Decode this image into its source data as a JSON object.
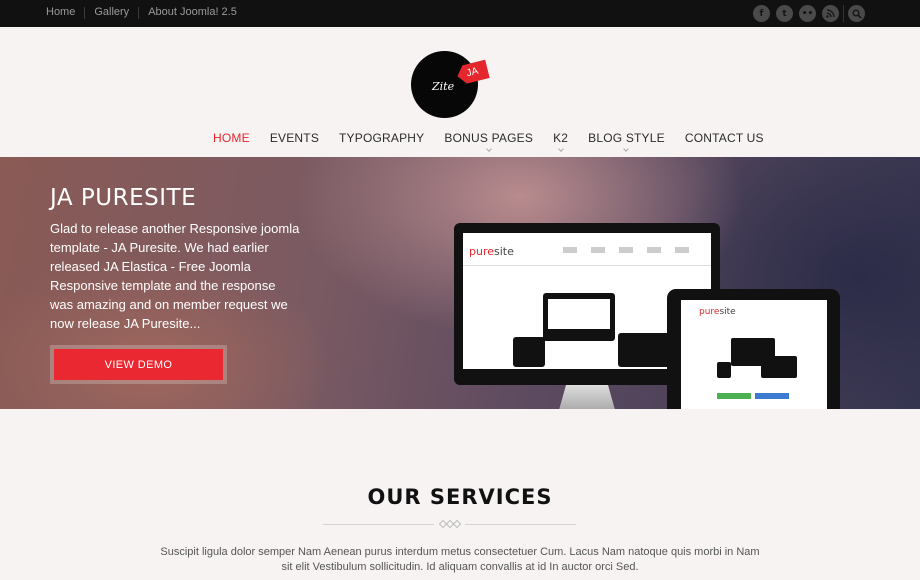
{
  "topbar": {
    "links": [
      "Home",
      "Gallery",
      "About Joomla! 2.5"
    ],
    "social_icons": [
      "facebook-icon",
      "twitter-icon",
      "flickr-icon",
      "rss-icon"
    ],
    "search_icon": "search-icon"
  },
  "logo": {
    "text": "Zite",
    "tag": "JA"
  },
  "nav": {
    "items": [
      "HOME",
      "EVENTS",
      "TYPOGRAPHY",
      "BONUS PAGES",
      "K2",
      "BLOG STYLE",
      "CONTACT US"
    ],
    "active": "HOME"
  },
  "hero": {
    "title": "JA PURESITE",
    "body": "Glad to release another Responsive joomla template - JA Puresite. We had earlier released JA Elastica - Free Joomla Responsive template and the response was amazing and on member request we now release JA Puresite...",
    "button": "VIEW DEMO",
    "screen_logo_main": "pure",
    "screen_logo_rest": "site"
  },
  "services": {
    "title": "OUR SERVICES",
    "body": "Suscipit ligula dolor semper Nam Aenean purus interdum metus consectetuer Cum. Lacus Nam natoque quis morbi in Nam sit elit Vestibulum sollicitudin. Id aliquam convallis at id In auctor orci Sed."
  },
  "colors": {
    "accent": "#e4272d",
    "topbar": "#111111",
    "background": "#f7f3f3"
  }
}
